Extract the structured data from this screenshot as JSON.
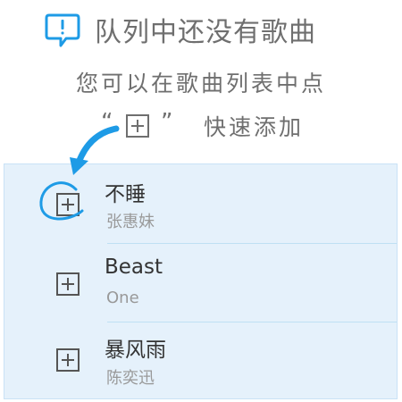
{
  "header": {
    "icon": "exclamation-bubble-icon",
    "title": "队列中还没有歌曲"
  },
  "hint": {
    "line1": "您可以在歌曲列表中点",
    "quote_open": "“",
    "quote_close": "”",
    "icon": "plus-box-icon",
    "suffix": "快速添加"
  },
  "songs": [
    {
      "name": "不睡",
      "artist": "张惠妹",
      "highlighted": true
    },
    {
      "name": "Beast",
      "artist": "One",
      "highlighted": false
    },
    {
      "name": "暴风雨",
      "artist": "陈奕迅",
      "highlighted": false
    }
  ],
  "colors": {
    "accent": "#1e9be6",
    "text_gray": "#6f6f6f",
    "list_bg": "#e5f1fb"
  }
}
